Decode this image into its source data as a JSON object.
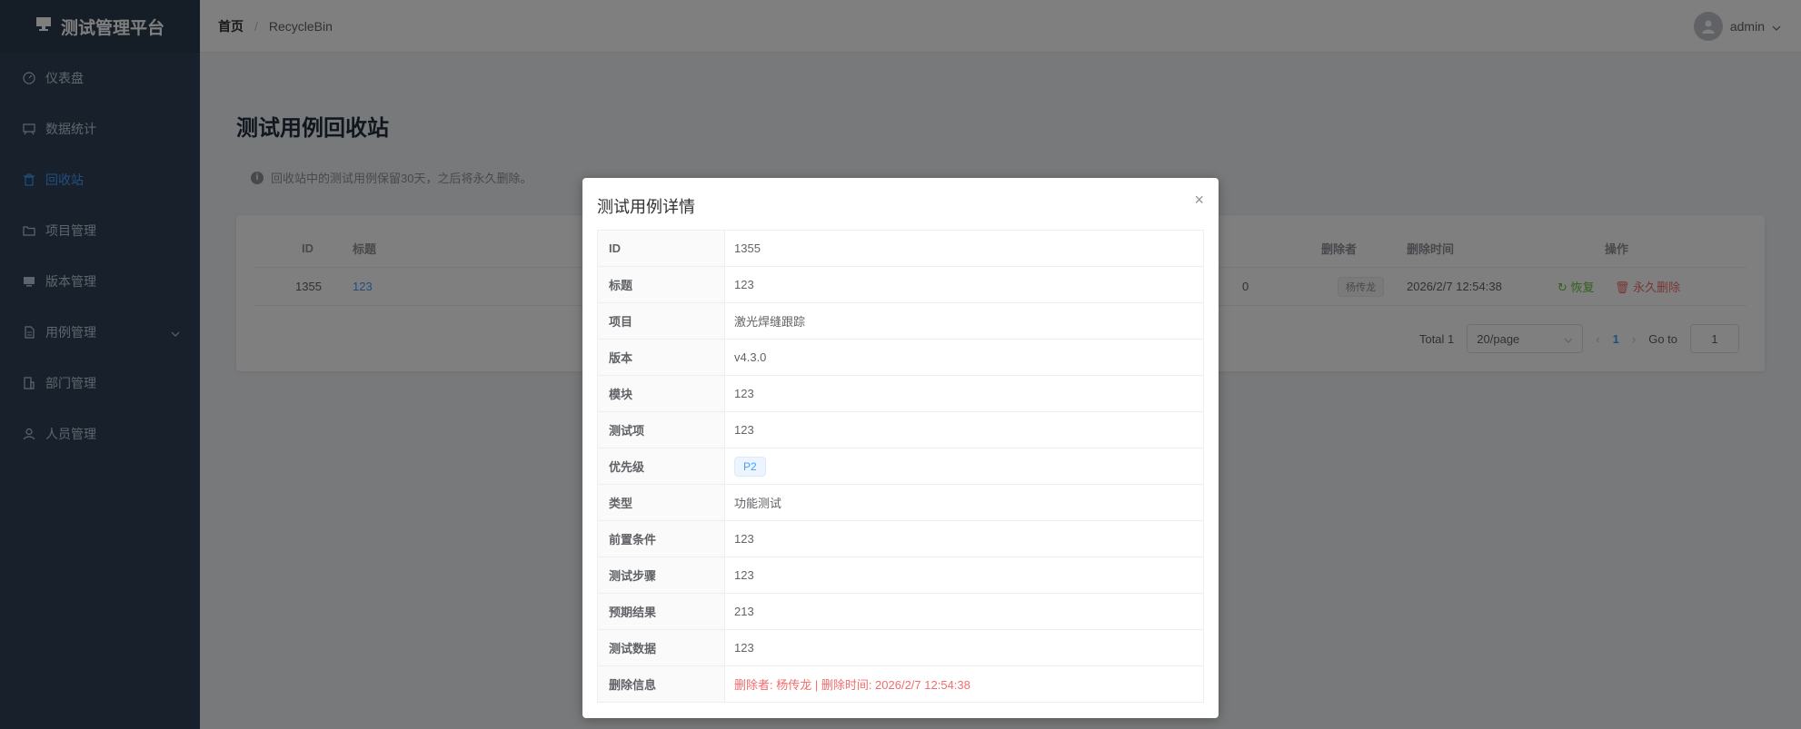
{
  "app": {
    "title": "测试管理平台"
  },
  "sidebar": {
    "items": [
      {
        "label": "仪表盘",
        "icon": "gauge-icon"
      },
      {
        "label": "数据统计",
        "icon": "chart-board-icon"
      },
      {
        "label": "回收站",
        "icon": "trash-icon",
        "active": true
      },
      {
        "label": "项目管理",
        "icon": "folder-icon"
      },
      {
        "label": "版本管理",
        "icon": "monitor-icon"
      },
      {
        "label": "用例管理",
        "icon": "document-icon",
        "has_submenu": true
      },
      {
        "label": "部门管理",
        "icon": "building-icon"
      },
      {
        "label": "人员管理",
        "icon": "user-icon"
      }
    ]
  },
  "header": {
    "breadcrumb": {
      "home": "首页",
      "separator": "/",
      "current": "RecycleBin"
    },
    "user": {
      "name": "admin"
    }
  },
  "page": {
    "title": "测试用例回收站",
    "tip": "回收站中的测试用例保留30天，之后将永久删除。"
  },
  "table": {
    "headers": {
      "id": "ID",
      "title": "标题",
      "deleter": "删除者",
      "delete_time": "删除时间",
      "actions": "操作"
    },
    "rows": [
      {
        "id": "1355",
        "title": "123",
        "partial": "0",
        "deleter": "杨传龙",
        "delete_time": "2026/2/7 12:54:38",
        "restore": "恢复",
        "delete": "永久删除"
      }
    ]
  },
  "pagination": {
    "total": "Total 1",
    "page_size": "20/page",
    "current_page": "1",
    "goto_label": "Go to",
    "goto_value": "1"
  },
  "dialog": {
    "title": "测试用例详情",
    "close": "×",
    "fields": [
      {
        "label": "ID",
        "value": "1355"
      },
      {
        "label": "标题",
        "value": "123"
      },
      {
        "label": "项目",
        "value": "激光焊缝跟踪"
      },
      {
        "label": "版本",
        "value": "v4.3.0"
      },
      {
        "label": "模块",
        "value": "123"
      },
      {
        "label": "测试项",
        "value": "123"
      },
      {
        "label": "优先级",
        "value": "P2",
        "type": "tag"
      },
      {
        "label": "类型",
        "value": "功能测试"
      },
      {
        "label": "前置条件",
        "value": "123"
      },
      {
        "label": "测试步骤",
        "value": "123"
      },
      {
        "label": "预期结果",
        "value": "213"
      },
      {
        "label": "测试数据",
        "value": "123"
      },
      {
        "label": "删除信息",
        "value": "删除者: 杨传龙 | 删除时间: 2026/2/7 12:54:38",
        "type": "danger"
      }
    ]
  },
  "colors": {
    "sidebar_bg": "#304156",
    "active": "#409eff",
    "success": "#67c23a",
    "danger": "#f56c6c"
  }
}
